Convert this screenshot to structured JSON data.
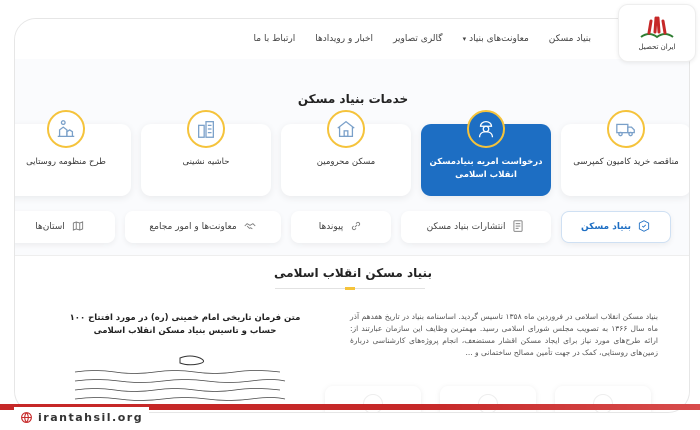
{
  "logo": {
    "text": "ایران تحصیل"
  },
  "nav": {
    "items": [
      {
        "label": "بنیاد مسکن",
        "has_dropdown": false
      },
      {
        "label": "معاونت‌های بنیاد",
        "has_dropdown": true
      },
      {
        "label": "گالری تصاویر",
        "has_dropdown": false
      },
      {
        "label": "اخبار و رویدادها",
        "has_dropdown": false
      },
      {
        "label": "ارتباط با ما",
        "has_dropdown": false
      }
    ]
  },
  "services": {
    "title": "خدمات بنیاد مسکن",
    "cards": [
      {
        "label": "مناقصه خرید کامیون کمپرسی",
        "icon": "truck-icon",
        "active": false
      },
      {
        "label": "درخواست امریه بنیادمسکن انقلاب اسلامی",
        "icon": "soldier-icon",
        "active": true
      },
      {
        "label": "مسکن محرومین",
        "icon": "house-icon",
        "active": false
      },
      {
        "label": "حاشیه نشینی",
        "icon": "buildings-icon",
        "active": false
      },
      {
        "label": "طرح منظومه روستایی",
        "icon": "village-icon",
        "active": false
      }
    ]
  },
  "tabs": [
    {
      "label": "بنیاد مسکن",
      "icon": "foundation-icon",
      "active": true
    },
    {
      "label": "انتشارات بنیاد مسکن",
      "icon": "publication-icon",
      "active": false
    },
    {
      "label": "پیوندها",
      "icon": "link-icon",
      "active": false
    },
    {
      "label": "معاونت‌ها و امور مجامع",
      "icon": "handshake-icon",
      "active": false
    },
    {
      "label": "استان‌ها",
      "icon": "map-icon",
      "active": false
    }
  ],
  "content": {
    "title": "بنیاد مسکن انقلاب اسلامی",
    "paragraph": "بنیاد مسکن انقلاب اسلامی در فروردین ماه ۱۳۵۸ تاسیس گردید. اساسنامه بنیاد در تاریخ هفدهم آذر ماه سال ۱۳۶۶ به تصویب مجلس شورای اسلامی رسید. مهمترین وظایف این سازمان عبارتند از: ارائه طرح‌های مورد نیاز برای ایجاد مسکن اقشار مستضعف، انجام پروژه‌های کارشناسی دربارهٔ زمین‌های روستایی، کمک در جهت تأمین مصالح ساختمانی و ...",
    "decree_title": "متن فرمان تاریخی امام خمینی (ره) در مورد افتتاح ۱۰۰ حساب و تاسیس بنیاد مسکن انقلاب اسلامی"
  },
  "footer": {
    "site": "irantahsil.org"
  },
  "colors": {
    "primary": "#1d6ec3",
    "accent": "#f5c33b",
    "brand_red": "#c62828"
  }
}
